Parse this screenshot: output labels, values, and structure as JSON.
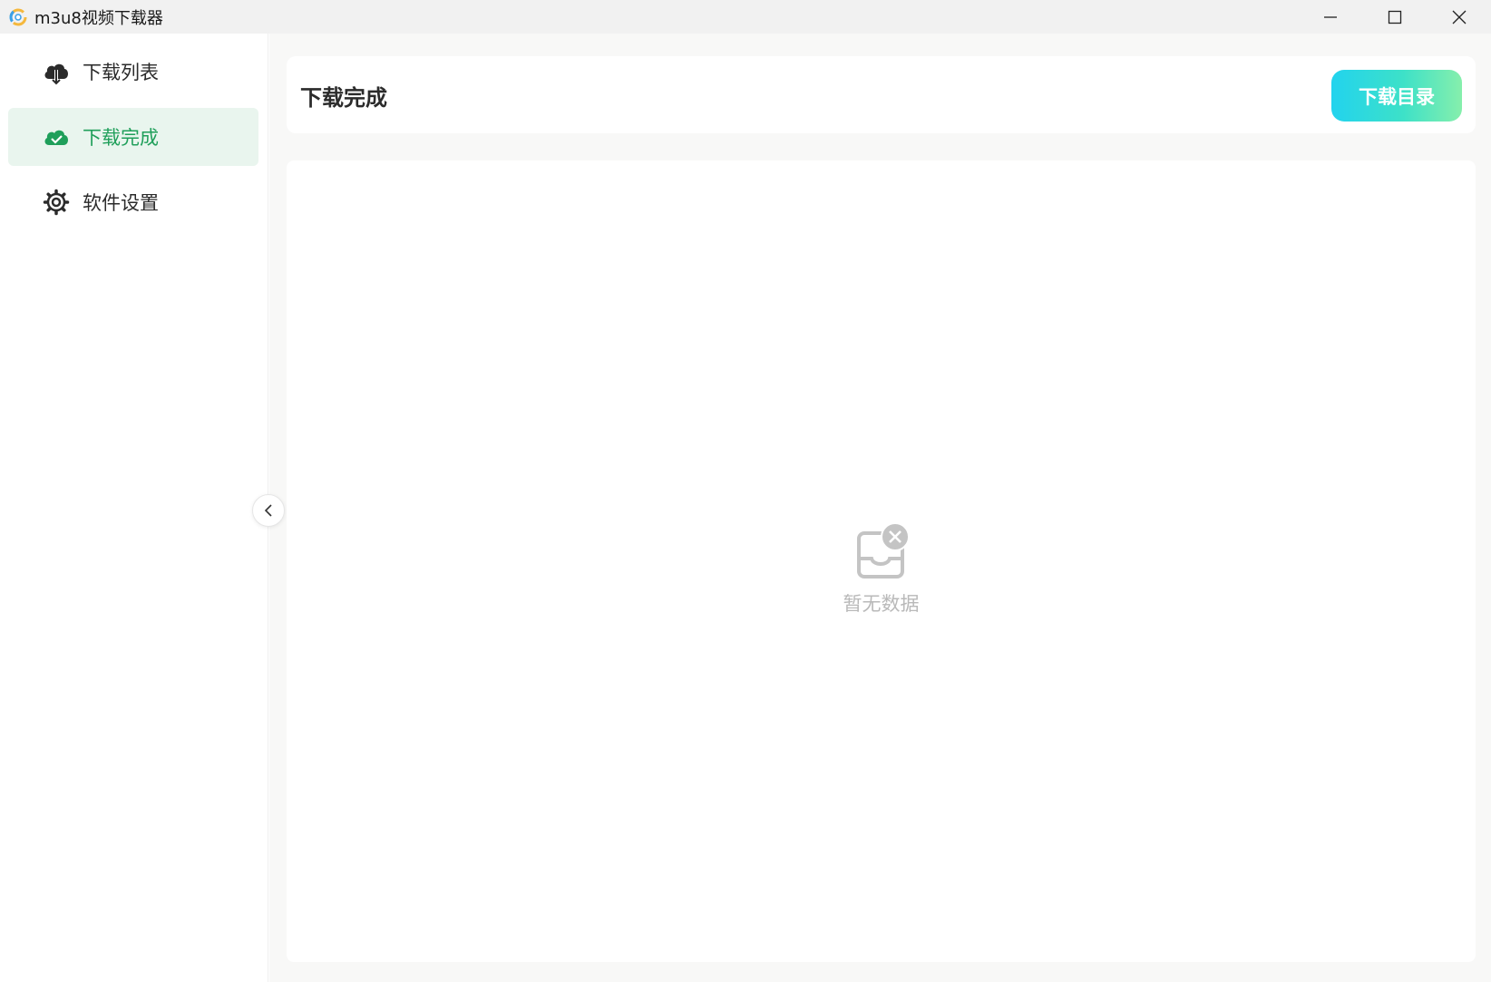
{
  "window": {
    "title": "m3u8视频下载器",
    "logo_icon": "app-logo-icon",
    "controls": [
      "minimize-icon",
      "maximize-icon",
      "close-icon"
    ]
  },
  "sidebar": {
    "items": [
      {
        "label": "下载列表",
        "icon": "cloud-download-icon",
        "active": false
      },
      {
        "label": "下载完成",
        "icon": "cloud-check-icon",
        "active": true
      },
      {
        "label": "软件设置",
        "icon": "gear-icon",
        "active": false
      }
    ],
    "collapse_icon": "chevron-left-icon"
  },
  "header": {
    "title": "下载完成",
    "dir_button_label": "下载目录"
  },
  "content": {
    "empty_text": "暂无数据",
    "empty_icon": "empty-inbox-icon"
  },
  "colors": {
    "accent_green": "#1f9f5a",
    "active_bg": "#e9f5ee",
    "button_gradient_start": "#22d3ee",
    "button_gradient_end": "#86efac",
    "empty_text": "#b9b9b9"
  }
}
